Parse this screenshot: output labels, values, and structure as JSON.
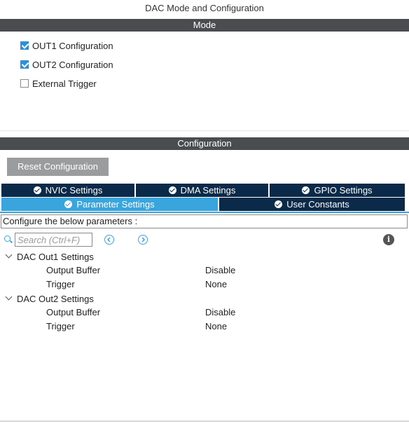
{
  "title": "DAC Mode and Configuration",
  "mode": {
    "header": "Mode",
    "options": [
      {
        "label": "OUT1 Configuration",
        "checked": true
      },
      {
        "label": "OUT2 Configuration",
        "checked": true
      },
      {
        "label": "External Trigger",
        "checked": false
      }
    ]
  },
  "configuration": {
    "header": "Configuration",
    "reset_label": "Reset Configuration",
    "tabs": [
      {
        "label": "NVIC Settings",
        "active": false
      },
      {
        "label": "DMA Settings",
        "active": false
      },
      {
        "label": "GPIO Settings",
        "active": false
      },
      {
        "label": "Parameter Settings",
        "active": true
      },
      {
        "label": "User Constants",
        "active": false
      }
    ],
    "instruction": "Configure the below parameters :",
    "search": {
      "placeholder": "Search (Ctrl+F)",
      "value": ""
    },
    "groups": [
      {
        "label": "DAC Out1 Settings",
        "params": [
          {
            "name": "Output Buffer",
            "value": "Disable"
          },
          {
            "name": "Trigger",
            "value": "None"
          }
        ]
      },
      {
        "label": "DAC Out2 Settings",
        "params": [
          {
            "name": "Output Buffer",
            "value": "Disable"
          },
          {
            "name": "Trigger",
            "value": "None"
          }
        ]
      }
    ]
  },
  "colors": {
    "section_bar": "#4a4d4f",
    "tab_dark": "#0b2a4a",
    "tab_active": "#3aa5dc",
    "checkbox": "#2f8fd6",
    "button_gray": "#9a9c9e"
  },
  "icons": [
    "check-icon",
    "search-icon",
    "previous-icon",
    "next-icon",
    "info-icon",
    "chevron-down-icon"
  ]
}
